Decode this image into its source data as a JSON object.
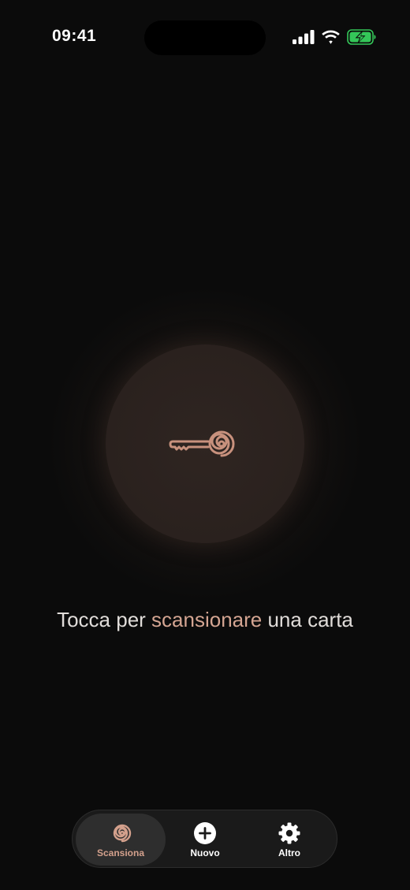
{
  "status_bar": {
    "time": "09:41",
    "icons": [
      "signal-icon",
      "wifi-icon",
      "battery-charging-icon"
    ]
  },
  "scan": {
    "icon": "key-spiral-icon",
    "prompt_prefix": "Tocca per ",
    "prompt_accent": "scansionare",
    "prompt_suffix": " una carta"
  },
  "tabbar": {
    "tabs": [
      {
        "label": "Scansiona",
        "icon": "spiral-icon",
        "active": true
      },
      {
        "label": "Nuovo",
        "icon": "plus-circle-icon",
        "active": false
      },
      {
        "label": "Altro",
        "icon": "gear-icon",
        "active": false
      }
    ]
  },
  "colors": {
    "background": "#0b0b0b",
    "accent": "#d4a592",
    "battery": "#34c759"
  }
}
